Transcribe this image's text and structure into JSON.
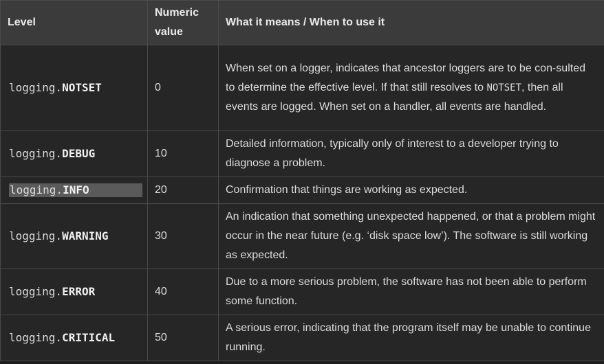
{
  "table": {
    "headers": {
      "level": "Level",
      "numeric": "Numeric value",
      "meaning": "What it means / When to use it"
    },
    "prefix": "logging.",
    "rows": [
      {
        "name": "NOTSET",
        "value": "0",
        "desc_before": "When set on a logger, indicates that ancestor loggers are to be con-sulted to determine the effective level. If that still resolves to ",
        "desc_code": "NOTSET",
        "desc_after": ", then all events are logged. When set on a handler, all events are handled."
      },
      {
        "name": "DEBUG",
        "value": "10",
        "desc": "Detailed information, typically only of interest to a developer trying to diagnose a problem."
      },
      {
        "name": "INFO",
        "value": "20",
        "desc": "Confirmation that things are working as expected.",
        "selected": true
      },
      {
        "name": "WARNING",
        "value": "30",
        "desc": "An indication that something unexpected happened, or that a problem might occur in the near future (e.g. ‘disk space low’). The software is still working as expected."
      },
      {
        "name": "ERROR",
        "value": "40",
        "desc": "Due to a more serious problem, the software has not been able to perform some function."
      },
      {
        "name": "CRITICAL",
        "value": "50",
        "desc": "A serious error, indicating that the program itself may be unable to continue running."
      }
    ]
  }
}
